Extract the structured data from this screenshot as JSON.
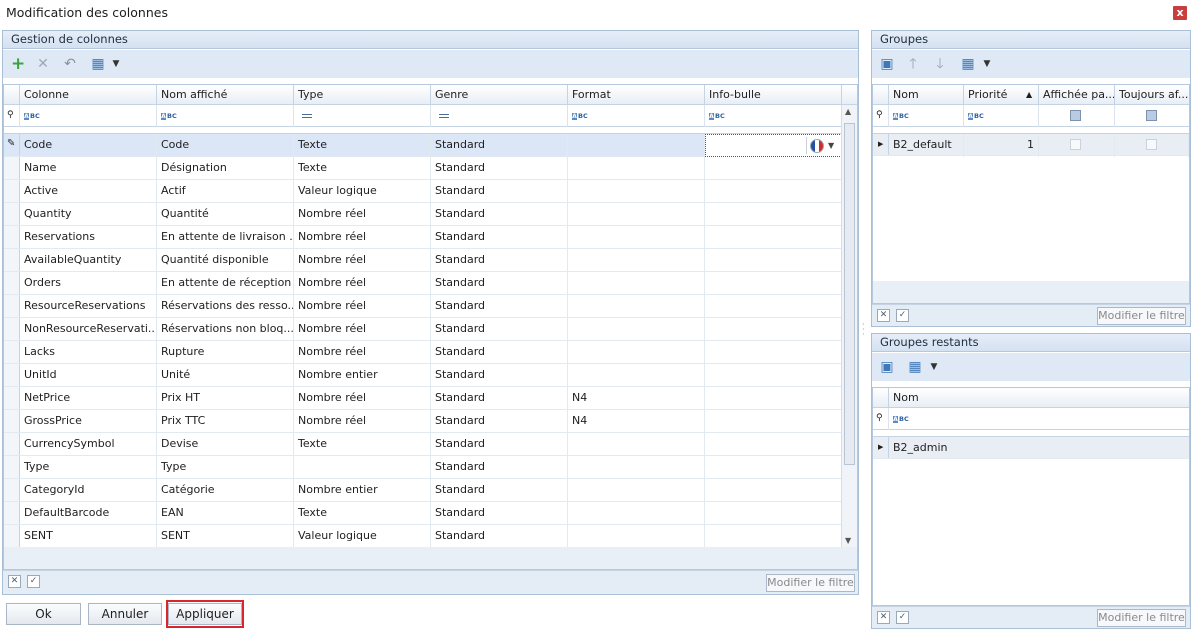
{
  "window": {
    "title": "Modification des colonnes",
    "close_label": "x"
  },
  "gestion": {
    "title": "Gestion de colonnes",
    "toolbar": [
      "add-icon",
      "delete-icon",
      "undo-icon",
      "layout-icon",
      "dropdown-icon"
    ],
    "columns": [
      "Colonne",
      "Nom affiché",
      "Type",
      "Genre",
      "Format",
      "Info-bulle"
    ],
    "rows": [
      [
        "Code",
        "Code",
        "Texte",
        "Standard",
        "",
        ""
      ],
      [
        "Name",
        "Désignation",
        "Texte",
        "Standard",
        "",
        ""
      ],
      [
        "Active",
        "Actif",
        "Valeur logique",
        "Standard",
        "",
        ""
      ],
      [
        "Quantity",
        "Quantité",
        "Nombre réel",
        "Standard",
        "",
        ""
      ],
      [
        "Reservations",
        "En attente de livraison ...",
        "Nombre réel",
        "Standard",
        "",
        ""
      ],
      [
        "AvailableQuantity",
        "Quantité disponible",
        "Nombre réel",
        "Standard",
        "",
        ""
      ],
      [
        "Orders",
        "En attente de réception",
        "Nombre réel",
        "Standard",
        "",
        ""
      ],
      [
        "ResourceReservations",
        "Réservations des resso...",
        "Nombre réel",
        "Standard",
        "",
        ""
      ],
      [
        "NonResourceReservati...",
        "Réservations non bloq...",
        "Nombre réel",
        "Standard",
        "",
        ""
      ],
      [
        "Lacks",
        "Rupture",
        "Nombre réel",
        "Standard",
        "",
        ""
      ],
      [
        "UnitId",
        "Unité",
        "Nombre entier",
        "Standard",
        "",
        ""
      ],
      [
        "NetPrice",
        "Prix HT",
        "Nombre réel",
        "Standard",
        "N4",
        ""
      ],
      [
        "GrossPrice",
        "Prix TTC",
        "Nombre réel",
        "Standard",
        "N4",
        ""
      ],
      [
        "CurrencySymbol",
        "Devise",
        "Texte",
        "Standard",
        "",
        ""
      ],
      [
        "Type",
        "Type",
        "",
        "Standard",
        "",
        ""
      ],
      [
        "CategoryId",
        "Catégorie",
        "Nombre entier",
        "Standard",
        "",
        ""
      ],
      [
        "DefaultBarcode",
        "EAN",
        "Texte",
        "Standard",
        "",
        ""
      ],
      [
        "SENT",
        "SENT",
        "Valeur logique",
        "Standard",
        "",
        ""
      ]
    ],
    "filter_button": "Modifier le filtre"
  },
  "groupes": {
    "title": "Groupes",
    "columns": [
      "Nom",
      "Priorité",
      "Affichée pa...",
      "Toujours af..."
    ],
    "rows": [
      {
        "name": "B2_default",
        "priority": "1"
      }
    ],
    "filter_button": "Modifier le filtre"
  },
  "restants": {
    "title": "Groupes restants",
    "columns": [
      "Nom"
    ],
    "rows": [
      {
        "name": "B2_admin"
      }
    ],
    "filter_button": "Modifier le filtre"
  },
  "buttons": {
    "ok": "Ok",
    "annuler": "Annuler",
    "appliquer": "Appliquer"
  },
  "colors": {
    "accent": "#d8262d",
    "header": "#d4e1f1",
    "selection": "#dbe7f6"
  }
}
